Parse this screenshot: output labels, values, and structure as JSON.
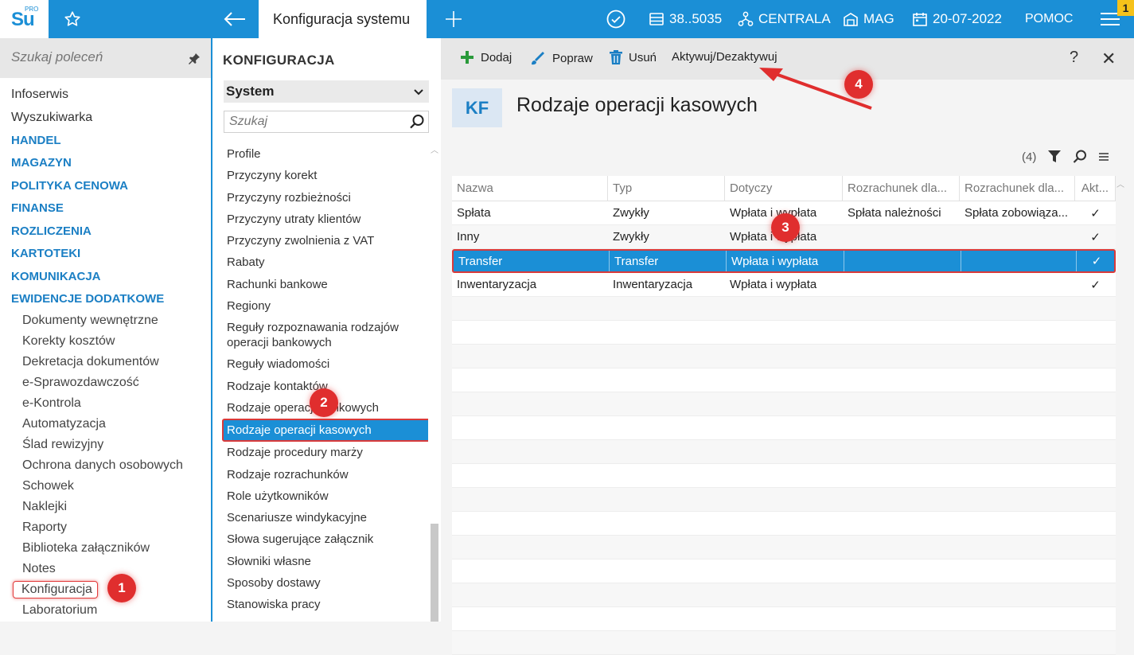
{
  "topbar": {
    "logo_text": "Su",
    "logo_sup": "PRO",
    "active_tab": "Konfiguracja systemu",
    "company_code": "38..5035",
    "branch": "CENTRALA",
    "warehouse": "MAG",
    "date": "20-07-2022",
    "help": "POMOC",
    "notification_count": "1"
  },
  "leftnav": {
    "search_placeholder": "Szukaj poleceń",
    "items": [
      {
        "label": "Infoserwis"
      },
      {
        "label": "Wyszukiwarka"
      },
      {
        "label": "HANDEL"
      },
      {
        "label": "MAGAZYN"
      },
      {
        "label": "POLITYKA CENOWA"
      },
      {
        "label": "FINANSE"
      },
      {
        "label": "ROZLICZENIA"
      },
      {
        "label": "KARTOTEKI"
      },
      {
        "label": "KOMUNIKACJA"
      },
      {
        "label": "EWIDENCJE DODATKOWE"
      }
    ],
    "subitems": [
      {
        "label": "Dokumenty wewnętrzne"
      },
      {
        "label": "Korekty kosztów"
      },
      {
        "label": "Dekretacja dokumentów"
      },
      {
        "label": "e-Sprawozdawczość"
      },
      {
        "label": "e-Kontrola"
      },
      {
        "label": "Automatyzacja"
      },
      {
        "label": "Ślad rewizyjny"
      },
      {
        "label": "Ochrona danych osobowych"
      },
      {
        "label": "Schowek"
      },
      {
        "label": "Naklejki"
      },
      {
        "label": "Raporty"
      },
      {
        "label": "Biblioteka załączników"
      },
      {
        "label": "Notes"
      },
      {
        "label": "Konfiguracja"
      },
      {
        "label": "Laboratorium"
      }
    ]
  },
  "midpane": {
    "title": "KONFIGURACJA",
    "section_select": "System",
    "search_placeholder": "Szukaj",
    "items": [
      {
        "label": "Profile"
      },
      {
        "label": "Przyczyny korekt"
      },
      {
        "label": "Przyczyny rozbieżności"
      },
      {
        "label": "Przyczyny utraty klientów"
      },
      {
        "label": "Przyczyny zwolnienia z VAT"
      },
      {
        "label": "Rabaty"
      },
      {
        "label": "Rachunki bankowe"
      },
      {
        "label": "Regiony"
      },
      {
        "label": "Reguły rozpoznawania rodzajów operacji bankowych"
      },
      {
        "label": "Reguły wiadomości"
      },
      {
        "label": "Rodzaje kontaktów"
      },
      {
        "label": "Rodzaje operacji bankowych"
      },
      {
        "label": "Rodzaje operacji kasowych"
      },
      {
        "label": "Rodzaje procedury marży"
      },
      {
        "label": "Rodzaje rozrachunków"
      },
      {
        "label": "Role użytkowników"
      },
      {
        "label": "Scenariusze windykacyjne"
      },
      {
        "label": "Słowa sugerujące załącznik"
      },
      {
        "label": "Słowniki własne"
      },
      {
        "label": "Sposoby dostawy"
      },
      {
        "label": "Stanowiska pracy"
      }
    ]
  },
  "toolbar": {
    "add": "Dodaj",
    "edit": "Popraw",
    "delete": "Usuń",
    "toggle": "Aktywuj/Dezaktywuj",
    "help": "?",
    "close": "✕"
  },
  "page": {
    "icon_text": "KF",
    "title": "Rodzaje operacji kasowych",
    "count": "(4)"
  },
  "grid": {
    "headers": [
      "Nazwa",
      "Typ",
      "Dotyczy",
      "Rozrachunek dla...",
      "Rozrachunek dla...",
      "Akt..."
    ],
    "rows": [
      {
        "nazwa": "Spłata",
        "typ": "Zwykły",
        "dotyczy": "Wpłata i wypłata",
        "roz1": "Spłata należności",
        "roz2": "Spłata zobowiąza...",
        "akt": "✓"
      },
      {
        "nazwa": "Inny",
        "typ": "Zwykły",
        "dotyczy": "Wpłata i wypłata",
        "roz1": "",
        "roz2": "",
        "akt": "✓"
      },
      {
        "nazwa": "Transfer",
        "typ": "Transfer",
        "dotyczy": "Wpłata i wypłata",
        "roz1": "",
        "roz2": "",
        "akt": "✓"
      },
      {
        "nazwa": "Inwentaryzacja",
        "typ": "Inwentaryzacja",
        "dotyczy": "Wpłata i wypłata",
        "roz1": "",
        "roz2": "",
        "akt": "✓"
      }
    ]
  },
  "markers": [
    "1",
    "2",
    "3",
    "4"
  ],
  "colors": {
    "accent": "#1b8fd6",
    "highlight": "#d93a3a",
    "badge": "#f6c21a"
  }
}
